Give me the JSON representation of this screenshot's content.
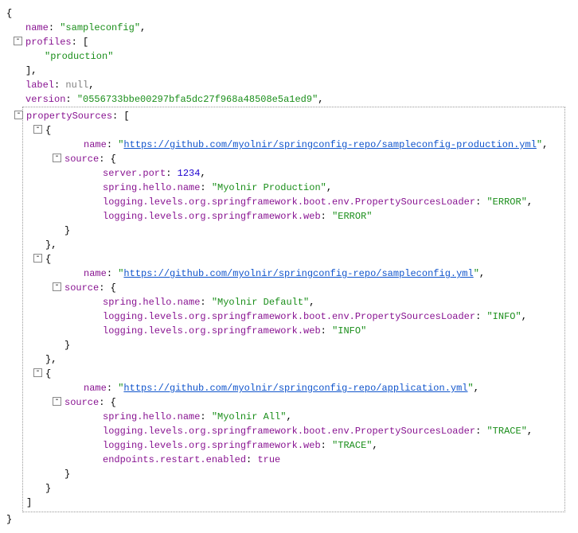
{
  "root": {
    "name_key": "name",
    "name_val": "\"sampleconfig\"",
    "profiles_key": "profiles",
    "profiles_val": "\"production\"",
    "label_key": "label",
    "label_val": "null",
    "version_key": "version",
    "version_val": "\"0556733bbe00297bfa5dc27f968a48508e5a1ed9\"",
    "propertySources_key": "propertySources"
  },
  "ps": [
    {
      "name_key": "name",
      "name_val": "\"https://github.com/myolnir/springconfig-repo/sampleconfig-production.yml\"",
      "source_key": "source",
      "props": [
        {
          "k": "server.port",
          "v": "1234",
          "type": "num"
        },
        {
          "k": "spring.hello.name",
          "v": "\"Myolnir Production\"",
          "type": "string"
        },
        {
          "k": "logging.levels.org.springframework.boot.env.PropertySourcesLoader",
          "v": "\"ERROR\"",
          "type": "string"
        },
        {
          "k": "logging.levels.org.springframework.web",
          "v": "\"ERROR\"",
          "type": "string",
          "last": true
        }
      ]
    },
    {
      "name_key": "name",
      "name_val": "\"https://github.com/myolnir/springconfig-repo/sampleconfig.yml\"",
      "source_key": "source",
      "props": [
        {
          "k": "spring.hello.name",
          "v": "\"Myolnir Default\"",
          "type": "string"
        },
        {
          "k": "logging.levels.org.springframework.boot.env.PropertySourcesLoader",
          "v": "\"INFO\"",
          "type": "string"
        },
        {
          "k": "logging.levels.org.springframework.web",
          "v": "\"INFO\"",
          "type": "string",
          "last": true
        }
      ]
    },
    {
      "name_key": "name",
      "name_val": "\"https://github.com/myolnir/springconfig-repo/application.yml\"",
      "source_key": "source",
      "props": [
        {
          "k": "spring.hello.name",
          "v": "\"Myolnir All\"",
          "type": "string"
        },
        {
          "k": "logging.levels.org.springframework.boot.env.PropertySourcesLoader",
          "v": "\"TRACE\"",
          "type": "string"
        },
        {
          "k": "logging.levels.org.springframework.web",
          "v": "\"TRACE\"",
          "type": "string"
        },
        {
          "k": "endpoints.restart.enabled",
          "v": "true",
          "type": "bool",
          "last": true
        }
      ]
    }
  ],
  "glyphs": {
    "minus": "-"
  }
}
